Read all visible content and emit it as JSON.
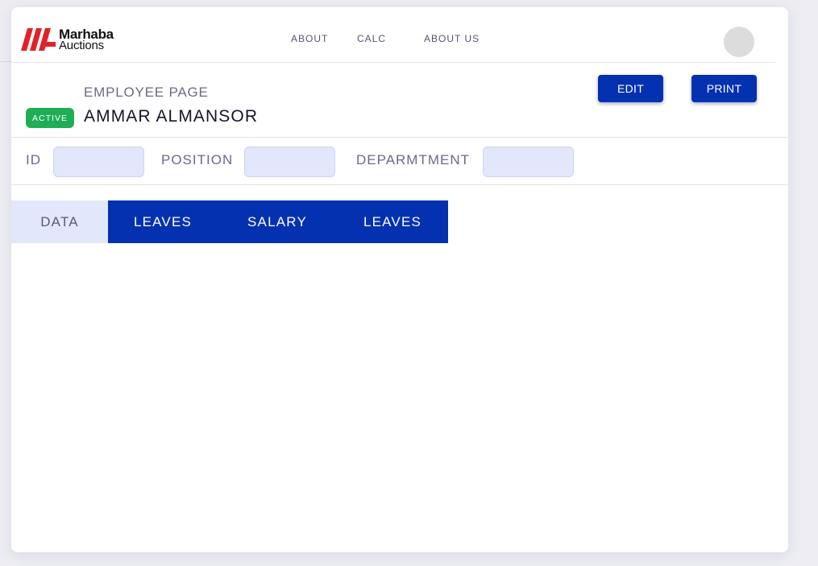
{
  "brand": {
    "line1": "Marhaba",
    "line2": "Auctions",
    "logo_color": "#e0212b"
  },
  "nav": {
    "links": [
      "ABOUT",
      "CALC",
      "ABOUT US"
    ]
  },
  "header": {
    "subtitle": "EMPLOYEE PAGE",
    "status": "ACTIVE",
    "status_color": "#1fae55",
    "employee_name": "AMMAR ALMANSOR",
    "edit_label": "EDIT",
    "print_label": "PRINT",
    "accent_color": "#0331b0"
  },
  "fields": {
    "id": {
      "label": "ID",
      "value": ""
    },
    "position": {
      "label": "POSITION",
      "value": ""
    },
    "department": {
      "label": "DEPARMTMENT",
      "value": ""
    }
  },
  "tabs": [
    "DATA",
    "LEAVES",
    "SALARY",
    "LEAVES"
  ],
  "active_tab": "DATA"
}
